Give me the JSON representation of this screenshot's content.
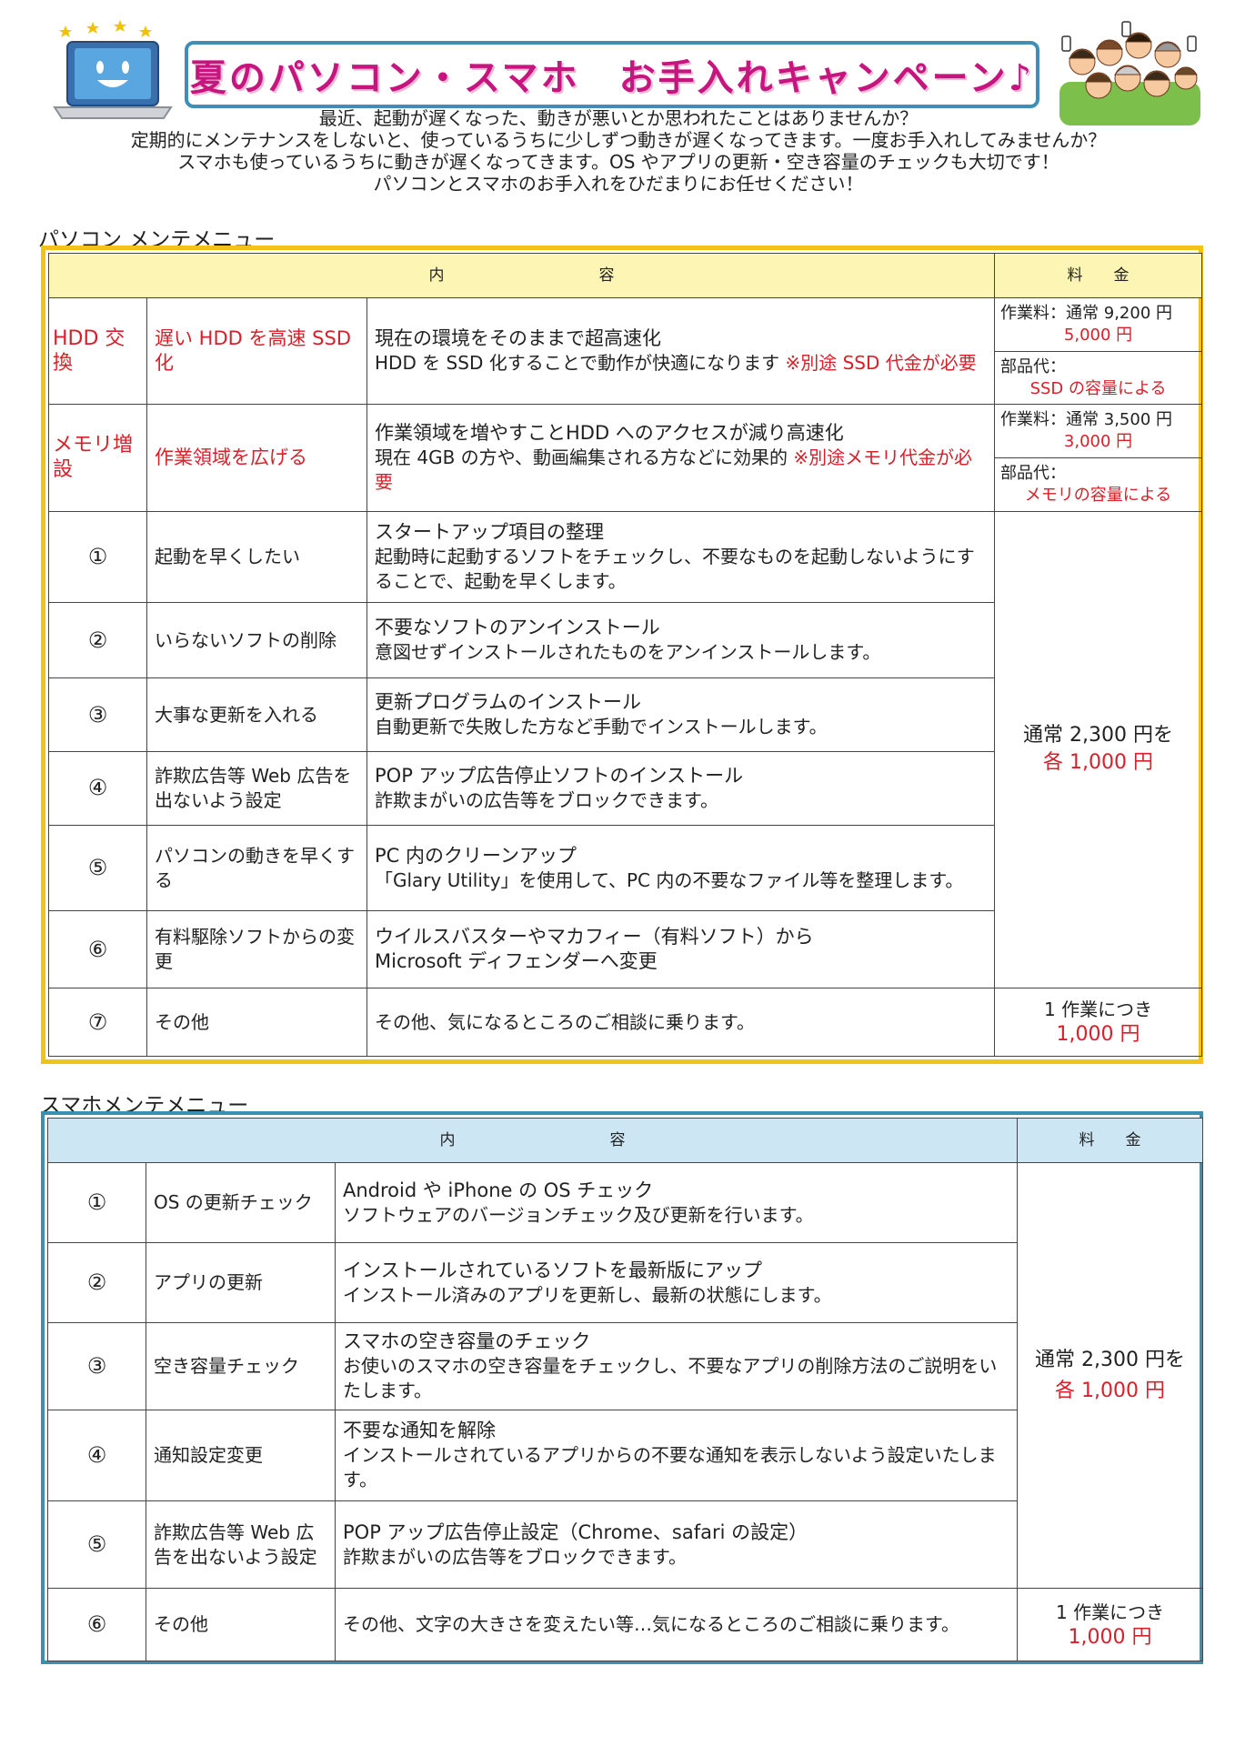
{
  "header": {
    "title": "夏のパソコン・スマホ　お手入れキャンペーン♪",
    "intro": [
      "最近、起動が遅くなった、動きが悪いとか思われたことはありませんか？",
      "定期的にメンテナンスをしないと、使っているうちに少しずつ動きが遅くなってきます。一度お手入れしてみませんか？",
      "スマホも使っているうちに動きが遅くなってきます。OS やアプリの更新・空き容量のチェックも大切です！",
      "パソコンとスマホのお手入れをひだまりにお任せください！"
    ]
  },
  "colors": {
    "accent_pink": "#c7157f",
    "red": "#d8202a",
    "pc_frame": "#f3c21a",
    "pc_header_bg": "#fdf5b4",
    "sp_frame": "#3b8fb0",
    "sp_header_bg": "#cde6f3"
  },
  "pc": {
    "section_title": "パソコン メンテメニュー",
    "header": {
      "content": "内　　　　　　　　　　容",
      "price": "料　　金"
    },
    "hdd": {
      "name": "HDD 交換",
      "target": "遅い HDD を高速 SSD 化",
      "title": "現在の環境をそのままで超高速化",
      "desc": "HDD を SSD 化することで動作が快適になります",
      "note": "※別途 SSD 代金が必要",
      "work_label": "作業料：通常 9,200 円",
      "work_price": "5,000 円",
      "parts_label": "部品代：",
      "parts_price": "SSD の容量による"
    },
    "mem": {
      "name": "メモリ増設",
      "target": "作業領域を広げる",
      "title": "作業領域を増やすことHDD へのアクセスが減り高速化",
      "desc": "現在 4GB の方や、動画編集される方などに効果的",
      "note": "※別途メモリ代金が必要",
      "work_label": "作業料：通常 3,500 円",
      "work_price": "3,000 円",
      "parts_label": "部品代：",
      "parts_price": "メモリの容量による"
    },
    "rows": [
      {
        "num": "①",
        "name": "起動を早くしたい",
        "title": "スタートアップ項目の整理",
        "desc": "起動時に起動するソフトをチェックし、不要なものを起動しないようにすることで、起動を早くします。"
      },
      {
        "num": "②",
        "name": "いらないソフトの削除",
        "title": "不要なソフトのアンインストール",
        "desc": "意図せずインストールされたものをアンインストールします。"
      },
      {
        "num": "③",
        "name": "大事な更新を入れる",
        "title": "更新プログラムのインストール",
        "desc": "自動更新で失敗した方など手動でインストールします。"
      },
      {
        "num": "④",
        "name": "詐欺広告等 Web 広告を出ないよう設定",
        "title": "POP アップ広告停止ソフトのインストール",
        "desc": "詐欺まがいの広告等をブロックできます。"
      },
      {
        "num": "⑤",
        "name": "パソコンの動きを早くする",
        "title": "PC 内のクリーンアップ",
        "desc": "「Glary Utility」を使用して、PC 内の不要なファイル等を整理します。"
      },
      {
        "num": "⑥",
        "name": "有料駆除ソフトからの変更",
        "title": "ウイルスバスターやマカフィー（有料ソフト）から",
        "desc": "Microsoft ディフェンダーへ変更"
      }
    ],
    "group_price": {
      "normal": "通常 2,300 円を",
      "sale": "各 1,000 円"
    },
    "other": {
      "num": "⑦",
      "name": "その他",
      "desc": "その他、気になるところのご相談に乗ります。",
      "price_label": "1 作業につき",
      "price": "1,000 円"
    }
  },
  "sp": {
    "section_title": "スマホメンテメニュー",
    "header": {
      "content": "内　　　　　　　　　　容",
      "price": "料　　金"
    },
    "rows": [
      {
        "num": "①",
        "name": "OS の更新チェック",
        "title": "Android や iPhone の OS チェック",
        "desc": "ソフトウェアのバージョンチェック及び更新を行います。"
      },
      {
        "num": "②",
        "name": "アプリの更新",
        "title": "インストールされているソフトを最新版にアップ",
        "desc": "インストール済みのアプリを更新し、最新の状態にします。"
      },
      {
        "num": "③",
        "name": "空き容量チェック",
        "title": "スマホの空き容量のチェック",
        "desc": "お使いのスマホの空き容量をチェックし、不要なアプリの削除方法のご説明をいたします。"
      },
      {
        "num": "④",
        "name": "通知設定変更",
        "title": "不要な通知を解除",
        "desc": "インストールされているアプリからの不要な通知を表示しないよう設定いたします。"
      },
      {
        "num": "⑤",
        "name": "詐欺広告等 Web 広告を出ないよう設定",
        "title": "POP アップ広告停止設定（Chrome、safari の設定）",
        "desc": "詐欺まがいの広告等をブロックできます。"
      }
    ],
    "group_price": {
      "normal": "通常 2,300 円を",
      "sale": "各 1,000 円"
    },
    "other": {
      "num": "⑥",
      "name": "その他",
      "desc": "その他、文字の大きさを変えたい等…気になるところのご相談に乗ります。",
      "price_label": "1 作業につき",
      "price": "1,000 円"
    }
  }
}
